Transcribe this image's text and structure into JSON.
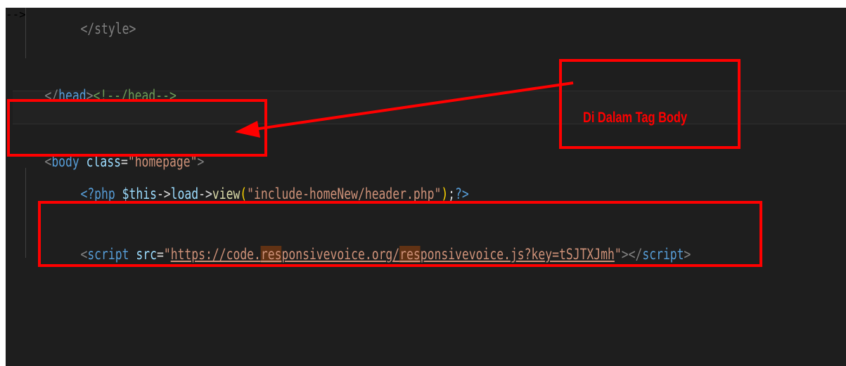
{
  "code": {
    "style_close": "</style>",
    "head_close": {
      "open_bracket": "</",
      "tag": "head",
      "close_bracket": ">",
      "comment": "<!--/head-->"
    },
    "body_open": {
      "open_bracket": "<",
      "tag": "body",
      "attr": "class",
      "eq": "=",
      "value": "\"homepage\"",
      "close_bracket": ">"
    },
    "php_line": {
      "open": "<?php",
      "var": "$this",
      "arrow1": "->",
      "load": "load",
      "arrow2": "->",
      "fn": "view",
      "lparen": "(",
      "arg": "\"include-homeNew/header.php\"",
      "rparen": ")",
      "semi": ";",
      "close": "?>"
    },
    "script_line": {
      "open_bracket": "<",
      "tag": "script",
      "attr": "src",
      "eq": "=",
      "quote_open": "\"",
      "url_part1": "https://code.",
      "url_hl1": "res",
      "url_part2": "ponsivevoice.org/",
      "url_hl2": "res",
      "url_part3": "ponsivevoice.js?key=tSJTXJmh",
      "quote_close": "\"",
      "close_bracket": ">",
      "end_open": "</",
      "end_tag": "script",
      "end_close": ">"
    }
  },
  "annotation": {
    "label": "Di Dalam Tag Body",
    "color": "#ff0000"
  },
  "theme": {
    "editor_bg": "#1e1e1e",
    "tag_color": "#569cd6",
    "attr_color": "#9cdcfe",
    "string_color": "#ce9178",
    "comment_color": "#6a9955"
  }
}
